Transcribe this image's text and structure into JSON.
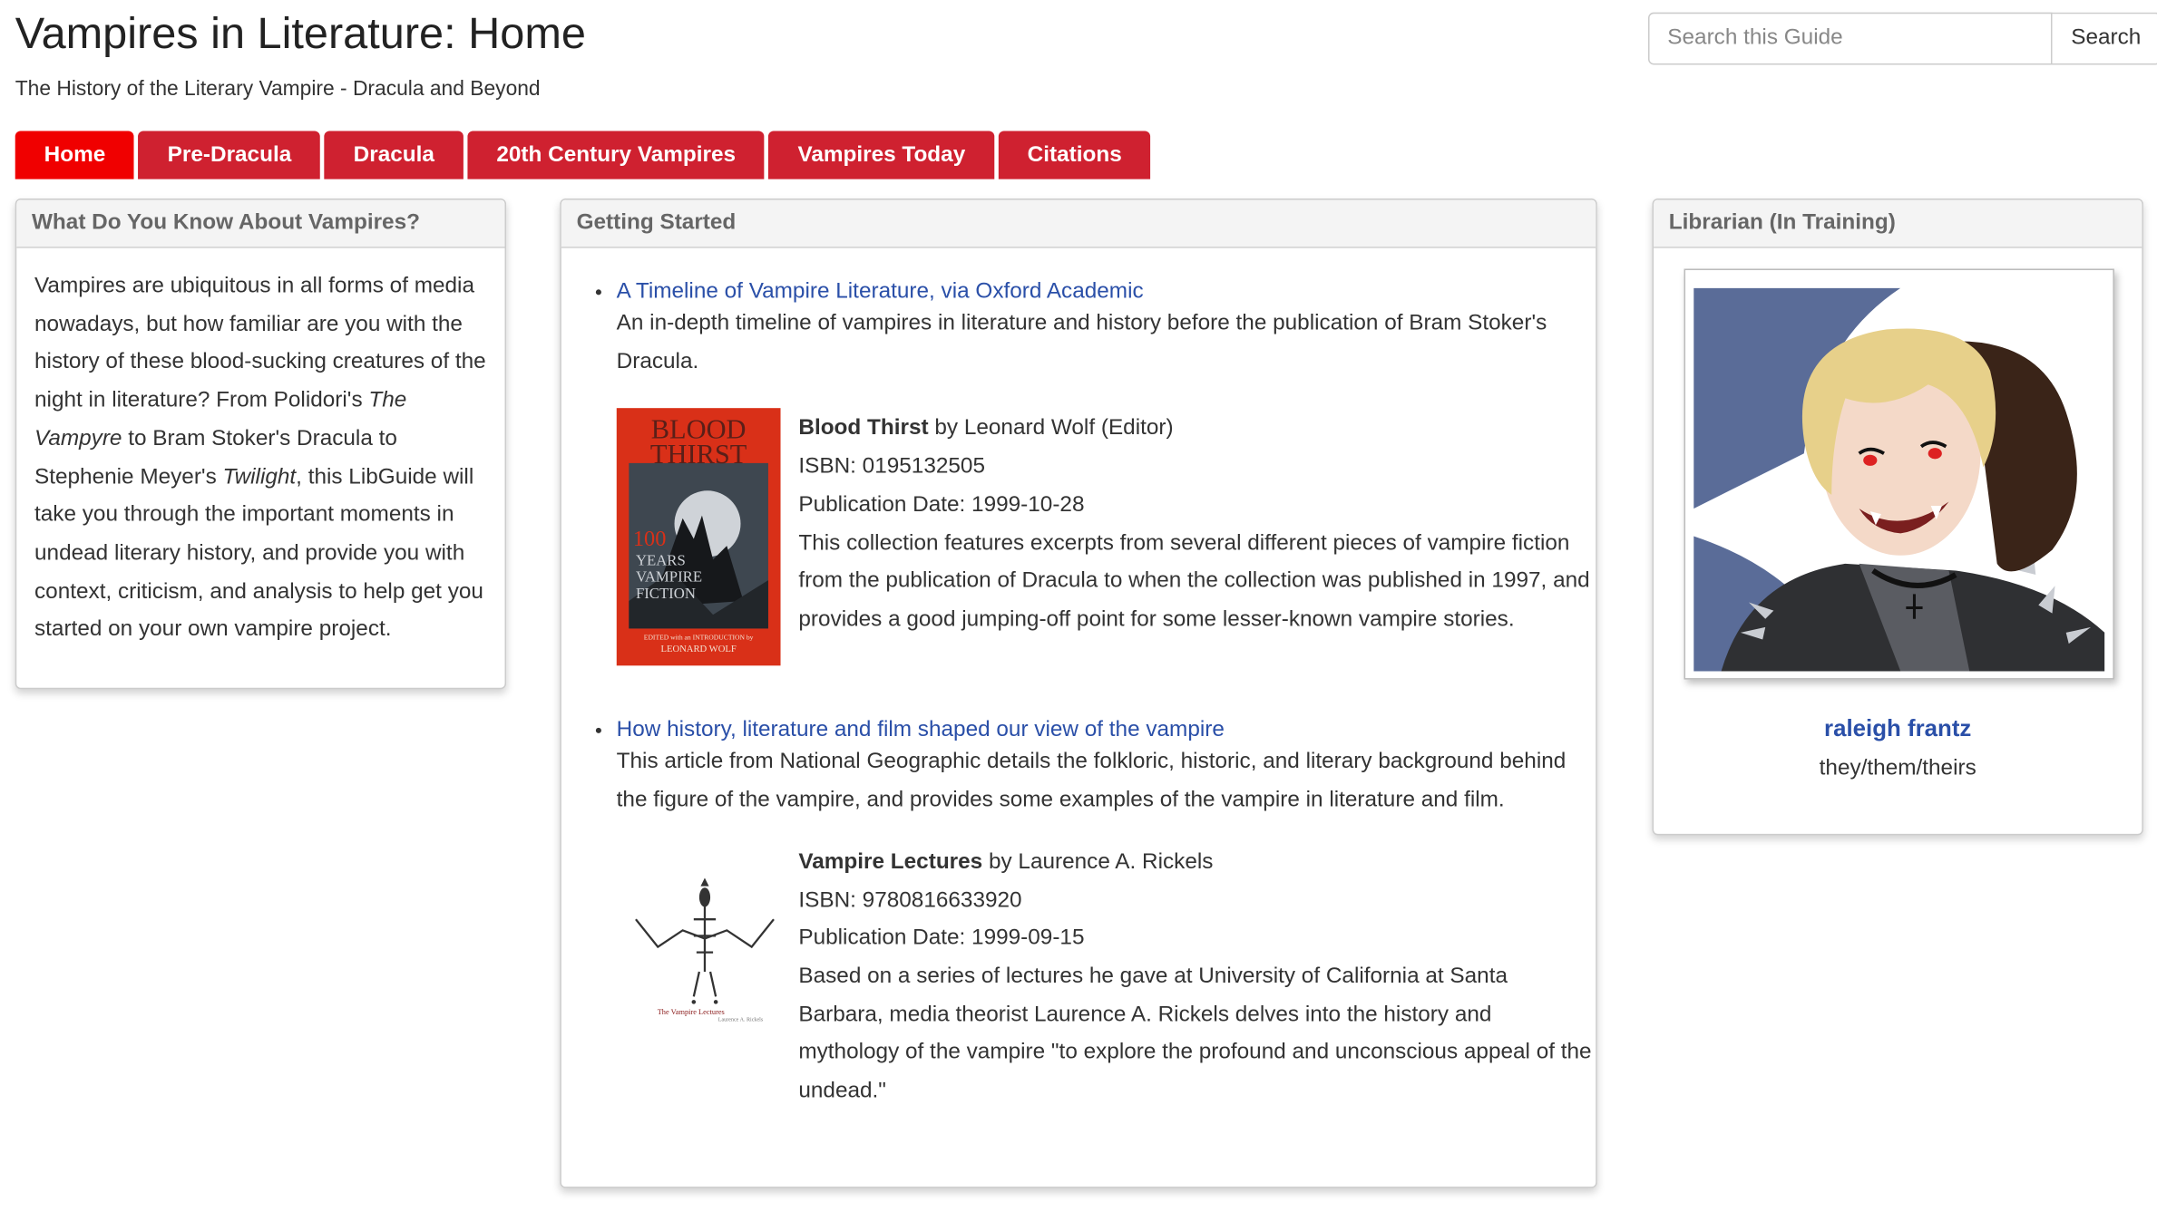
{
  "header": {
    "title": "Vampires in Literature: Home",
    "subtitle": "The History of the Literary Vampire - Dracula and Beyond"
  },
  "search": {
    "placeholder": "Search this Guide",
    "button_label": "Search"
  },
  "nav": {
    "tabs": [
      {
        "label": "Home",
        "active": true
      },
      {
        "label": "Pre-Dracula",
        "active": false
      },
      {
        "label": "Dracula",
        "active": false
      },
      {
        "label": "20th Century Vampires",
        "active": false
      },
      {
        "label": "Vampires Today",
        "active": false
      },
      {
        "label": "Citations",
        "active": false
      }
    ]
  },
  "about_box": {
    "heading": "What Do You Know About Vampires?",
    "p1": "Vampires are ubiquitous in all forms of media nowadays, but how familiar are you with the history of these blood-sucking creatures of the night in literature? From Polidori's ",
    "em1": "The Vampyre",
    "p2": " to Bram Stoker's Dracula to Stephenie Meyer's ",
    "em2": "Twilight",
    "p3": ", this LibGuide will take you through the important moments in undead literary history, and provide you with context, criticism, and analysis to help get you started on your own vampire project."
  },
  "getting_started": {
    "heading": "Getting Started",
    "items": [
      {
        "link": "A Timeline of Vampire Literature, via Oxford Academic",
        "description": "An in-depth timeline of vampires in literature and history before the publication of Bram Stoker's Dracula.",
        "book": {
          "title": "Blood Thirst",
          "by": " by Leonard Wolf (Editor)",
          "isbn": "ISBN: 0195132505",
          "date": "Publication Date: 1999-10-28",
          "summary": "This collection features excerpts from several different pieces of vampire fiction from the publication of Dracula to when the collection was published in 1997, and provides a good jumping-off point for some lesser-known vampire stories.",
          "cover": {
            "line1": "BLOOD",
            "line2": "THIRST",
            "line3": "100",
            "line4": "YEARS",
            "line5": "VAMPIRE",
            "line6": "FICTION",
            "line7": "EDITED with an INTRODUCTION by",
            "line8": "LEONARD WOLF"
          }
        }
      },
      {
        "link": "How history, literature and film shaped our view of the vampire",
        "description": "This article from National Geographic details the folkloric, historic, and literary background behind the figure of the vampire, and provides some examples of the vampire in literature and film.",
        "book": {
          "title": "Vampire Lectures",
          "by": " by Laurence A. Rickels",
          "isbn": "ISBN: 9780816633920",
          "date": "Publication Date: 1999-09-15",
          "summary": "Based on a series of lectures he gave at University of California at Santa Barbara, media theorist Laurence A. Rickels delves into the history and mythology of the vampire \"to explore the profound and unconscious appeal of the undead.\"",
          "cover": {
            "line1": "The Vampire Lectures",
            "line2": "Laurence A. Rickels"
          }
        }
      }
    ]
  },
  "librarian": {
    "heading": "Librarian (In Training)",
    "name": "raleigh frantz",
    "pronouns": "they/them/theirs"
  },
  "colors": {
    "tab_active": "#f00000",
    "tab": "#cf2130",
    "link": "#2a4fa8",
    "panel_header_bg": "#f4f4f4"
  }
}
